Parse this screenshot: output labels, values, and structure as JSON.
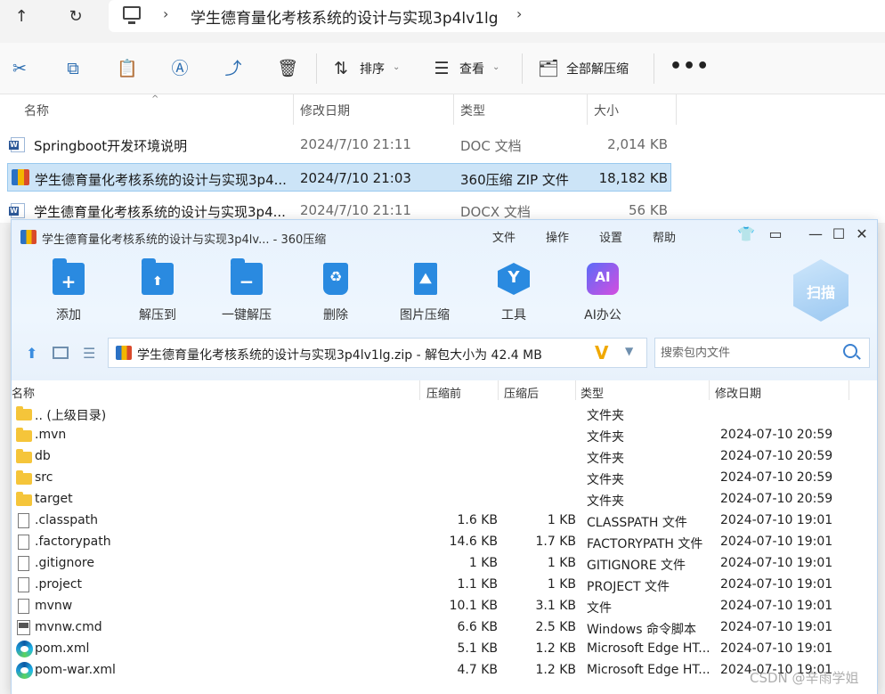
{
  "explorer": {
    "path_segment": "学生德育量化考核系统的设计与实现3p4lv1lg",
    "toolbar": {
      "sort_label": "排序",
      "view_label": "查看",
      "extract_all_label": "全部解压缩",
      "more_label": "•••"
    },
    "columns": {
      "name": "名称",
      "date": "修改日期",
      "type": "类型",
      "size": "大小"
    },
    "files": [
      {
        "name": "Springboot开发环境说明",
        "date": "2024/7/10 21:11",
        "type": "DOC 文档",
        "size": "2,014 KB",
        "icon": "word-doc-icon"
      },
      {
        "name": "学生德育量化考核系统的设计与实现3p4...",
        "date": "2024/7/10 21:03",
        "type": "360压缩 ZIP 文件",
        "size": "18,182 KB",
        "icon": "zip-icon",
        "selected": true
      },
      {
        "name": "学生德育量化考核系统的设计与实现3p4...",
        "date": "2024/7/10 21:11",
        "type": "DOCX 文档",
        "size": "56 KB",
        "icon": "word-doc-icon"
      }
    ]
  },
  "zipwin": {
    "title": "学生德育量化考核系统的设计与实现3p4lv... - 360压缩",
    "menu": [
      "文件",
      "操作",
      "设置",
      "帮助"
    ],
    "window_controls": {
      "shirt": "👕",
      "feedback": "▭",
      "minimize": "—",
      "maximize": "☐",
      "close": "✕"
    },
    "tools": [
      "添加",
      "解压到",
      "一键解压",
      "删除",
      "图片压缩",
      "工具",
      "AI办公"
    ],
    "tool_glyphs": {
      "add": "+",
      "extract": "⬆",
      "oneclick": "−",
      "delete": "♻",
      "image": "⛰",
      "tool": "Y",
      "ai": "AI"
    },
    "scan_label": "扫描",
    "path_text": "学生德育量化考核系统的设计与实现3p4lv1lg.zip - 解包大小为 42.4 MB",
    "search_placeholder": "搜索包内文件",
    "columns": {
      "name": "名称",
      "packed": "压缩前",
      "compressed": "压缩后",
      "type": "类型",
      "date": "修改日期"
    },
    "rows": [
      {
        "name": ".. (上级目录)",
        "packed": "",
        "compressed": "",
        "type": "文件夹",
        "date": "",
        "icon": "folder"
      },
      {
        "name": ".mvn",
        "packed": "",
        "compressed": "",
        "type": "文件夹",
        "date": "2024-07-10 20:59",
        "icon": "folder"
      },
      {
        "name": "db",
        "packed": "",
        "compressed": "",
        "type": "文件夹",
        "date": "2024-07-10 20:59",
        "icon": "folder"
      },
      {
        "name": "src",
        "packed": "",
        "compressed": "",
        "type": "文件夹",
        "date": "2024-07-10 20:59",
        "icon": "folder"
      },
      {
        "name": "target",
        "packed": "",
        "compressed": "",
        "type": "文件夹",
        "date": "2024-07-10 20:59",
        "icon": "folder"
      },
      {
        "name": ".classpath",
        "packed": "1.6 KB",
        "compressed": "1 KB",
        "type": "CLASSPATH 文件",
        "date": "2024-07-10 19:01",
        "icon": "file"
      },
      {
        "name": ".factorypath",
        "packed": "14.6 KB",
        "compressed": "1.7 KB",
        "type": "FACTORYPATH 文件",
        "date": "2024-07-10 19:01",
        "icon": "file"
      },
      {
        "name": ".gitignore",
        "packed": "1 KB",
        "compressed": "1 KB",
        "type": "GITIGNORE 文件",
        "date": "2024-07-10 19:01",
        "icon": "file"
      },
      {
        "name": ".project",
        "packed": "1.1 KB",
        "compressed": "1 KB",
        "type": "PROJECT 文件",
        "date": "2024-07-10 19:01",
        "icon": "file"
      },
      {
        "name": "mvnw",
        "packed": "10.1 KB",
        "compressed": "3.1 KB",
        "type": "文件",
        "date": "2024-07-10 19:01",
        "icon": "file"
      },
      {
        "name": "mvnw.cmd",
        "packed": "6.6 KB",
        "compressed": "2.5 KB",
        "type": "Windows 命令脚本",
        "date": "2024-07-10 19:01",
        "icon": "cmd"
      },
      {
        "name": "pom.xml",
        "packed": "5.1 KB",
        "compressed": "1.2 KB",
        "type": "Microsoft Edge HT...",
        "date": "2024-07-10 19:01",
        "icon": "edge"
      },
      {
        "name": "pom-war.xml",
        "packed": "4.7 KB",
        "compressed": "1.2 KB",
        "type": "Microsoft Edge HT...",
        "date": "2024-07-10 19:01",
        "icon": "edge"
      }
    ]
  },
  "watermark": "CSDN @辛雨学姐"
}
